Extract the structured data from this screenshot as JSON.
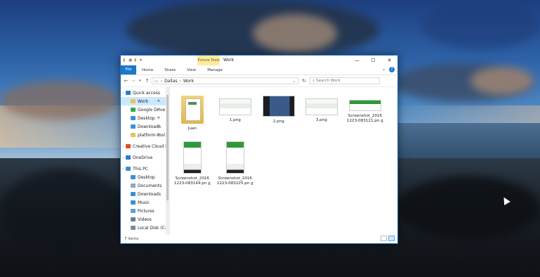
{
  "window": {
    "title": "Work",
    "context_tab": "Picture Tools",
    "controls": {
      "minimize": "—",
      "maximize": "☐",
      "close": "✕"
    }
  },
  "ribbon": {
    "tabs": [
      "File",
      "Home",
      "Share",
      "View",
      "Manage"
    ],
    "expand_icon": "⌄",
    "help_icon": "?"
  },
  "address": {
    "path": [
      "Dallas",
      "Work"
    ],
    "search_placeholder": "Search Work"
  },
  "nav": {
    "items": [
      {
        "label": "Quick access",
        "icon": "star-icon",
        "color": "#2a7bd4",
        "level": 0,
        "pinned": false,
        "selected": false
      },
      {
        "label": "Work",
        "icon": "folder-icon",
        "color": "#e8c25a",
        "level": 1,
        "pinned": true,
        "selected": true
      },
      {
        "label": "Google Drive",
        "icon": "google-drive-icon",
        "color": "#34a853",
        "level": 1,
        "pinned": true,
        "selected": false
      },
      {
        "label": "Desktop",
        "icon": "desktop-icon",
        "color": "#3c8fd6",
        "level": 1,
        "pinned": true,
        "selected": false
      },
      {
        "label": "Downloads",
        "icon": "downloads-icon",
        "color": "#3c8fd6",
        "level": 1,
        "pinned": true,
        "selected": false
      },
      {
        "label": "platform-tool",
        "icon": "folder-icon",
        "color": "#e8c25a",
        "level": 1,
        "pinned": true,
        "selected": false
      },
      {
        "label": "Creative Cloud Fil",
        "icon": "creative-cloud-icon",
        "color": "#e04c2b",
        "level": 0,
        "pinned": false,
        "selected": false
      },
      {
        "label": "OneDrive",
        "icon": "onedrive-icon",
        "color": "#2a7bd4",
        "level": 0,
        "pinned": false,
        "selected": false
      },
      {
        "label": "This PC",
        "icon": "pc-icon",
        "color": "#3c8fd6",
        "level": 0,
        "pinned": false,
        "selected": false
      },
      {
        "label": "Desktop",
        "icon": "desktop-icon",
        "color": "#3c8fd6",
        "level": 1,
        "pinned": false,
        "selected": false
      },
      {
        "label": "Documents",
        "icon": "documents-icon",
        "color": "#8aa8c8",
        "level": 1,
        "pinned": false,
        "selected": false
      },
      {
        "label": "Downloads",
        "icon": "downloads-icon",
        "color": "#3c8fd6",
        "level": 1,
        "pinned": false,
        "selected": false
      },
      {
        "label": "Music",
        "icon": "music-icon",
        "color": "#3c8fd6",
        "level": 1,
        "pinned": false,
        "selected": false
      },
      {
        "label": "Pictures",
        "icon": "pictures-icon",
        "color": "#5aa0dc",
        "level": 1,
        "pinned": false,
        "selected": false
      },
      {
        "label": "Videos",
        "icon": "videos-icon",
        "color": "#6a7fa0",
        "level": 1,
        "pinned": false,
        "selected": false
      },
      {
        "label": "Local Disk (C:)",
        "icon": "disk-icon",
        "color": "#7a8a99",
        "level": 1,
        "pinned": false,
        "selected": false
      }
    ]
  },
  "files": [
    {
      "name": "Juan",
      "kind": "folder"
    },
    {
      "name": "1.png",
      "kind": "image-wide"
    },
    {
      "name": "2.png",
      "kind": "image-dark"
    },
    {
      "name": "3.png",
      "kind": "image-wide"
    },
    {
      "name": "Screenshot_2016 1223-083121.pn g",
      "kind": "image-wide-green"
    },
    {
      "name": "Screenshot_2016 1223-083144.pn g",
      "kind": "image-phone"
    },
    {
      "name": "Screenshot_2016 1223-083225.pn g",
      "kind": "image-phone"
    }
  ],
  "status": {
    "item_count": "7 items"
  }
}
